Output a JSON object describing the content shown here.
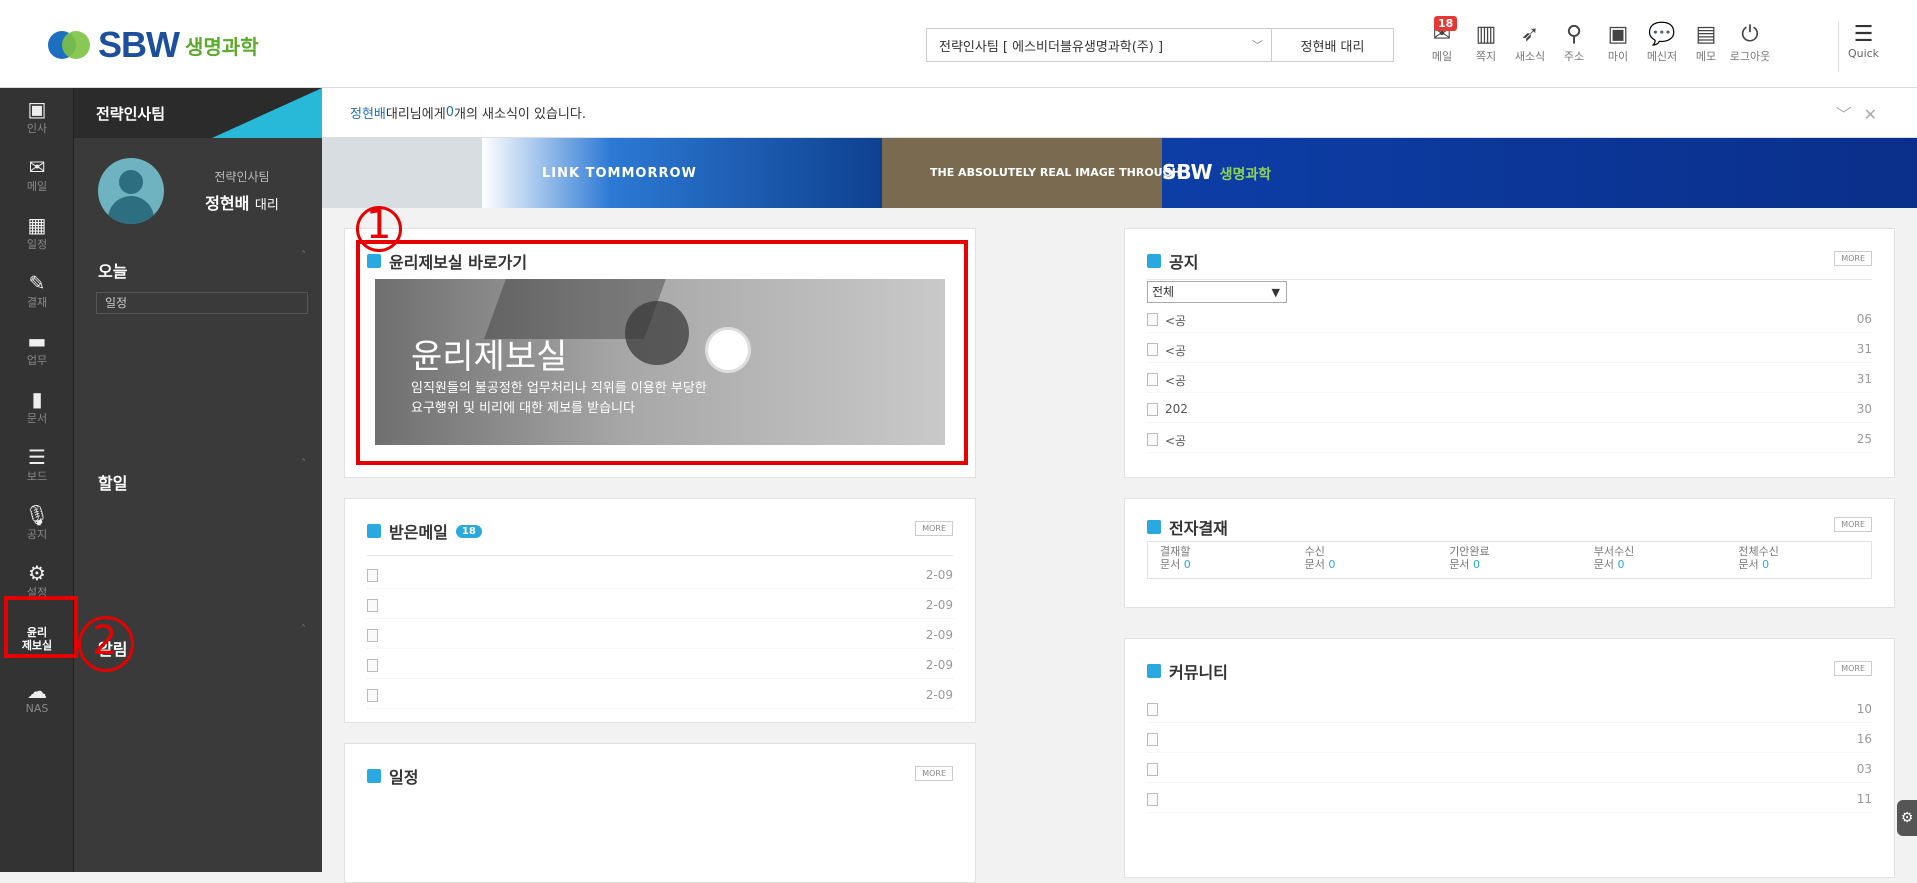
{
  "brand": {
    "logo_text": "SBW",
    "logo_sub": "생명과학"
  },
  "header": {
    "company": "전략인사팀 [ 에스비더블유생명과학(주) ]",
    "user": "정현배 대리",
    "icons": [
      {
        "name": "mail-icon",
        "label": "메일",
        "glyph": "✉",
        "badge": "18"
      },
      {
        "name": "memo-icon",
        "label": "쪽지",
        "glyph": "▥",
        "badge": ""
      },
      {
        "name": "news-icon",
        "label": "새소식",
        "glyph": "➶",
        "badge": ""
      },
      {
        "name": "address-icon",
        "label": "주소",
        "glyph": "⚲",
        "badge": ""
      },
      {
        "name": "my-icon",
        "label": "마이",
        "glyph": "▣",
        "badge": ""
      },
      {
        "name": "messenger-icon",
        "label": "메신저",
        "glyph": "💬",
        "badge": ""
      },
      {
        "name": "note-icon",
        "label": "메모",
        "glyph": "▤",
        "badge": ""
      },
      {
        "name": "logout-icon",
        "label": "로그아웃",
        "glyph": "⏻",
        "badge": ""
      }
    ],
    "quick_label": "Quick"
  },
  "iconbar": [
    {
      "name": "hr-icon",
      "label": "인사",
      "glyph": "▣"
    },
    {
      "name": "mail-icon",
      "label": "메일",
      "glyph": "✉"
    },
    {
      "name": "calendar-icon",
      "label": "일정",
      "glyph": "▦"
    },
    {
      "name": "approval-icon",
      "label": "결재",
      "glyph": "✎"
    },
    {
      "name": "work-icon",
      "label": "업무",
      "glyph": "▬"
    },
    {
      "name": "document-icon",
      "label": "문서",
      "glyph": "▮"
    },
    {
      "name": "board-icon",
      "label": "보드",
      "glyph": "☰"
    },
    {
      "name": "notice-icon",
      "label": "공지",
      "glyph": "🎙"
    },
    {
      "name": "settings-icon",
      "label": "설정",
      "glyph": "⚙"
    },
    {
      "name": "ethics-icon",
      "label": "윤리\n제보실",
      "glyph": ""
    },
    {
      "name": "nas-icon",
      "label": "NAS",
      "glyph": "☁"
    }
  ],
  "sidebar": {
    "team": "전략인사팀",
    "dept": "전략인사팀",
    "name": "정현배",
    "rank": "대리",
    "today": "오늘",
    "schedule": "일정",
    "todo": "할일",
    "alerts": "알림"
  },
  "notice_bar": {
    "prefix": "정현배",
    "middle": " 대리님에게 ",
    "count": "0",
    "suffix": "개의 새소식이 있습니다."
  },
  "banner": {
    "t1": "LINK TOMMORROW",
    "t2": "THE ABSOLUTELY REAL IMAGE THROUGH",
    "t3": "SBW",
    "t3_sub": "생명과학"
  },
  "ethics": {
    "title": "윤리제보실 바로가기",
    "img_title": "윤리제보실",
    "img_desc1": "임직원들의 불공정한 업무처리나 직위를 이용한 부당한",
    "img_desc2": "요구행위 및 비리에 대한 제보를 받습니다"
  },
  "annotations": {
    "n1": "1",
    "n2": "2"
  },
  "notice": {
    "title": "공지",
    "more": "MORE",
    "filter": "전체",
    "rows": [
      {
        "text": "<공",
        "date": "06"
      },
      {
        "text": "<공",
        "date": "31"
      },
      {
        "text": "<공",
        "date": "31"
      },
      {
        "text": "202",
        "date": "30"
      },
      {
        "text": "<공",
        "date": "25"
      }
    ]
  },
  "mail": {
    "title": "받은메일",
    "badge": "18",
    "more": "MORE",
    "rows": [
      {
        "date": "2-09"
      },
      {
        "date": "2-09"
      },
      {
        "date": "2-09"
      },
      {
        "date": "2-09"
      },
      {
        "date": "2-09"
      }
    ]
  },
  "approval": {
    "title": "전자결재",
    "more": "MORE",
    "cols": [
      {
        "l1": "결재할",
        "l2": "문서",
        "n": "0"
      },
      {
        "l1": "수신",
        "l2": "문서",
        "n": "0"
      },
      {
        "l1": "기안완료",
        "l2": "문서",
        "n": "0"
      },
      {
        "l1": "부서수신",
        "l2": "문서",
        "n": "0"
      },
      {
        "l1": "전체수신",
        "l2": "문서",
        "n": "0"
      }
    ]
  },
  "community": {
    "title": "커뮤니티",
    "more": "MORE",
    "rows": [
      {
        "date": "10"
      },
      {
        "date": "16"
      },
      {
        "date": "03"
      },
      {
        "date": "11"
      }
    ]
  },
  "calendar": {
    "title": "일정",
    "more": "MORE"
  }
}
